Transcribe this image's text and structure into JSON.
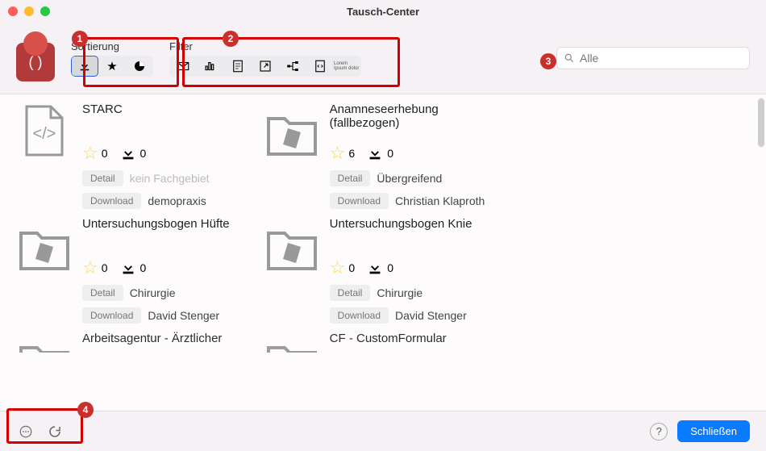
{
  "window": {
    "title": "Tausch-Center"
  },
  "toolbar": {
    "sort_label": "Sortierung",
    "filter_label": "Filter"
  },
  "search": {
    "placeholder": "Alle"
  },
  "badges": {
    "b1": "1",
    "b2": "2",
    "b3": "3",
    "b4": "4"
  },
  "buttons": {
    "detail": "Detail",
    "download": "Download",
    "close": "Schließen",
    "help": "?"
  },
  "filter_lorem": "Lorem Ipsum dolor",
  "cards": [
    {
      "title": "STARC",
      "stars": "0",
      "downloads": "0",
      "subject": "kein Fachgebiet",
      "subject_dim": true,
      "author": "demopraxis",
      "icon": "code"
    },
    {
      "title": "Anamneseerhebung (fallbezogen)",
      "stars": "6",
      "downloads": "0",
      "subject": "Übergreifend",
      "subject_dim": false,
      "author": "Christian Klaproth",
      "icon": "folder"
    },
    {
      "title": "",
      "stars": "",
      "downloads": "",
      "subject": "",
      "author": "",
      "icon": "none"
    },
    {
      "title": "Untersuchungsbogen Hüfte",
      "stars": "0",
      "downloads": "0",
      "subject": "Chirurgie",
      "subject_dim": false,
      "author": "David Stenger",
      "icon": "folder"
    },
    {
      "title": "Untersuchungsbogen Knie",
      "stars": "0",
      "downloads": "0",
      "subject": "Chirurgie",
      "subject_dim": false,
      "author": "David Stenger",
      "icon": "folder"
    },
    {
      "title": "",
      "stars": "",
      "downloads": "",
      "subject": "",
      "author": "",
      "icon": "none"
    },
    {
      "title": "Arbeitsagentur - Ärztlicher",
      "stars": "",
      "downloads": "",
      "subject": "",
      "author": "",
      "icon": "folder-cut"
    },
    {
      "title": "CF - CustomFormular",
      "stars": "",
      "downloads": "",
      "subject": "",
      "author": "",
      "icon": "folder-cut"
    }
  ]
}
